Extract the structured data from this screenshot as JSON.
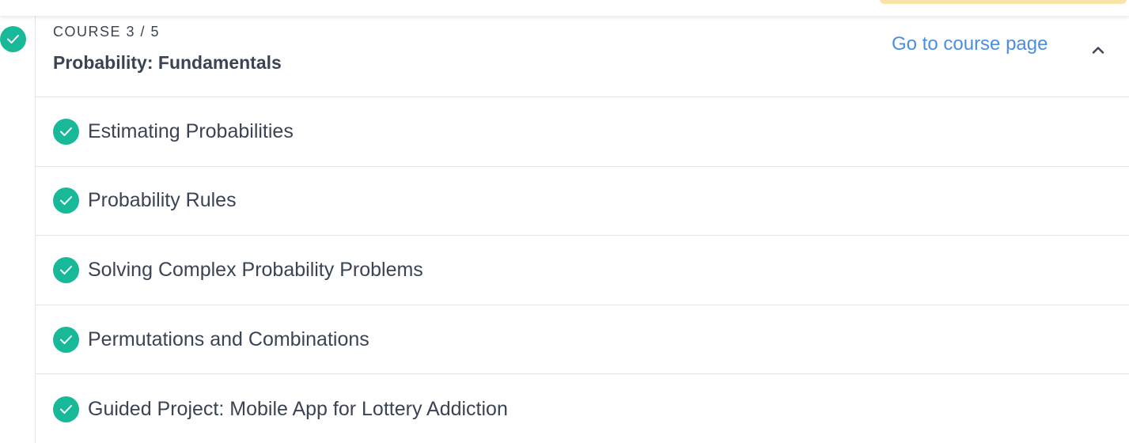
{
  "colors": {
    "accent_green": "#18b999",
    "link_blue": "#4a8fe2",
    "text_dark": "#3b4454",
    "divider": "#e2e4e8",
    "top_banner_yellow": "#f9e3a8"
  },
  "course": {
    "status_icon": "check-circle-icon",
    "counter": "COURSE 3 / 5",
    "title": "Probability: Fundamentals",
    "link_label": "Go to course page",
    "toggle_icon": "chevron-up-icon"
  },
  "lessons": [
    {
      "label": "Estimating Probabilities",
      "status_icon": "check-circle-icon"
    },
    {
      "label": "Probability Rules",
      "status_icon": "check-circle-icon"
    },
    {
      "label": "Solving Complex Probability Problems",
      "status_icon": "check-circle-icon"
    },
    {
      "label": "Permutations and Combinations",
      "status_icon": "check-circle-icon"
    },
    {
      "label": "Guided Project: Mobile App for Lottery Addiction",
      "status_icon": "check-circle-icon"
    }
  ]
}
